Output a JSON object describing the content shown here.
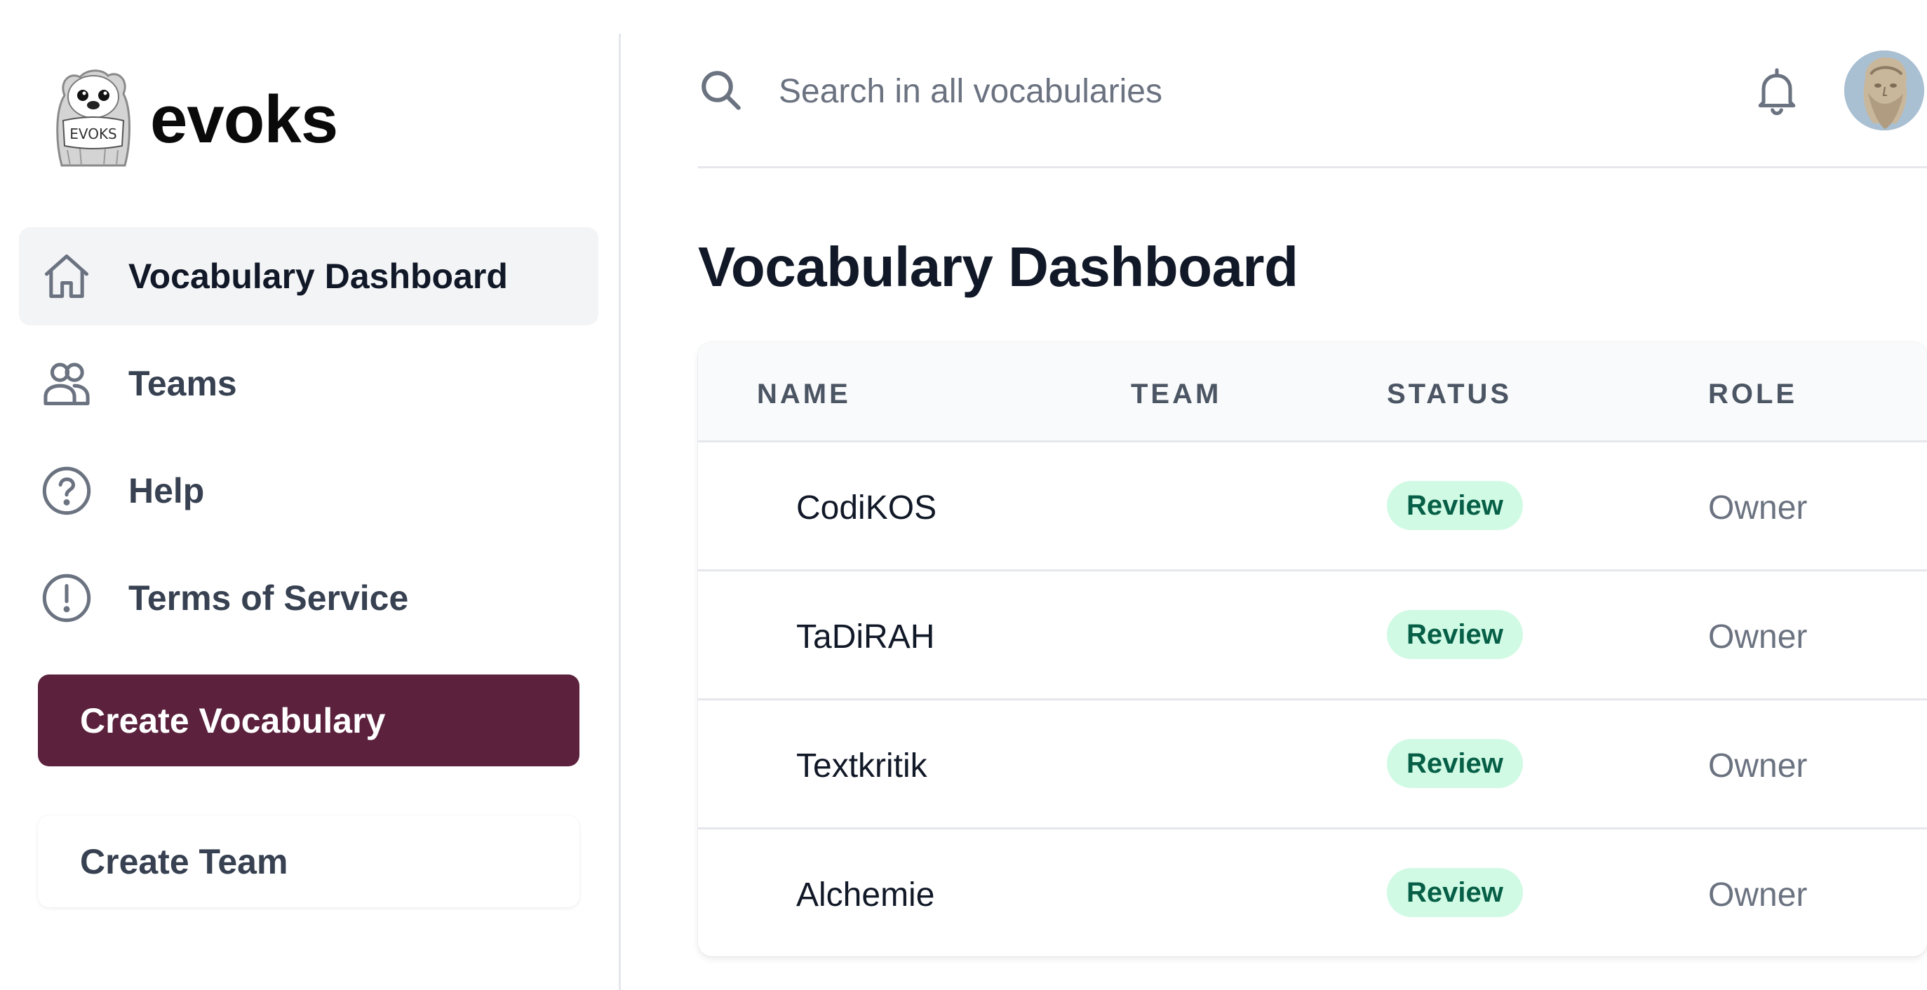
{
  "brand": {
    "name": "evoks",
    "mascot_text": "EVOKS"
  },
  "sidebar": {
    "items": [
      {
        "label": "Vocabulary Dashboard",
        "icon": "home-icon",
        "active": true
      },
      {
        "label": "Teams",
        "icon": "users-icon",
        "active": false
      },
      {
        "label": "Help",
        "icon": "question-circle-icon",
        "active": false
      },
      {
        "label": "Terms of Service",
        "icon": "exclamation-circle-icon",
        "active": false
      }
    ],
    "create_vocabulary_label": "Create Vocabulary",
    "create_team_label": "Create Team"
  },
  "header": {
    "search_placeholder": "Search in all vocabularies",
    "notification_icon": "bell-icon"
  },
  "main": {
    "title": "Vocabulary Dashboard",
    "table": {
      "headers": {
        "name": "NAME",
        "team": "TEAM",
        "status": "STATUS",
        "role": "ROLE"
      },
      "rows": [
        {
          "name": "CodiKOS",
          "team": "",
          "status": "Review",
          "role": "Owner"
        },
        {
          "name": "TaDiRAH",
          "team": "",
          "status": "Review",
          "role": "Owner"
        },
        {
          "name": "Textkritik",
          "team": "",
          "status": "Review",
          "role": "Owner"
        },
        {
          "name": "Alchemie",
          "team": "",
          "status": "Review",
          "role": "Owner"
        }
      ]
    }
  },
  "colors": {
    "primary": "#5b213d",
    "badge_bg": "#d1fae5",
    "badge_text": "#065f46",
    "active_nav_bg": "#f3f4f6"
  }
}
